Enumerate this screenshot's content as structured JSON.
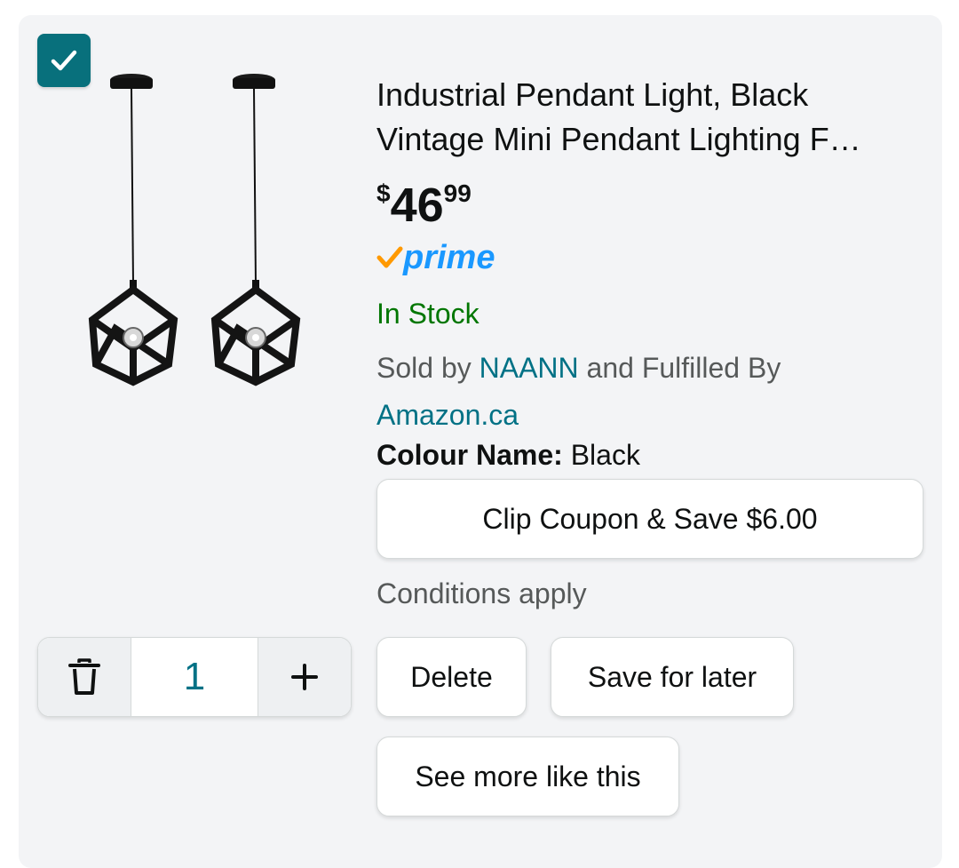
{
  "item": {
    "selected": true,
    "title_line1": "Industrial Pendant Light, Black",
    "title_line2": "Vintage Mini Pendant Lighting F…",
    "price": {
      "symbol": "$",
      "whole": "46",
      "fraction": "99"
    },
    "prime_label": "prime",
    "stock_status": "In Stock",
    "sold_by_prefix": "Sold by",
    "seller": "NAANN",
    "fulfilled_text": "and Fulfilled By",
    "fulfiller": "Amazon.ca",
    "colour_label": "Colour Name:",
    "colour_value": "Black",
    "coupon_button": "Clip Coupon & Save $6.00",
    "conditions": "Conditions apply",
    "quantity": "1"
  },
  "actions": {
    "delete": "Delete",
    "save_for_later": "Save for later",
    "see_more": "See more like this"
  },
  "colors": {
    "checkbox": "#08707c",
    "link": "#007185",
    "in_stock": "#007600",
    "prime_blue": "#1a98ff",
    "prime_check": "#ff9900"
  },
  "icons": {
    "checkbox": "check-icon",
    "prime": "prime-check-icon",
    "delete": "trash-icon",
    "increase": "plus-icon"
  }
}
